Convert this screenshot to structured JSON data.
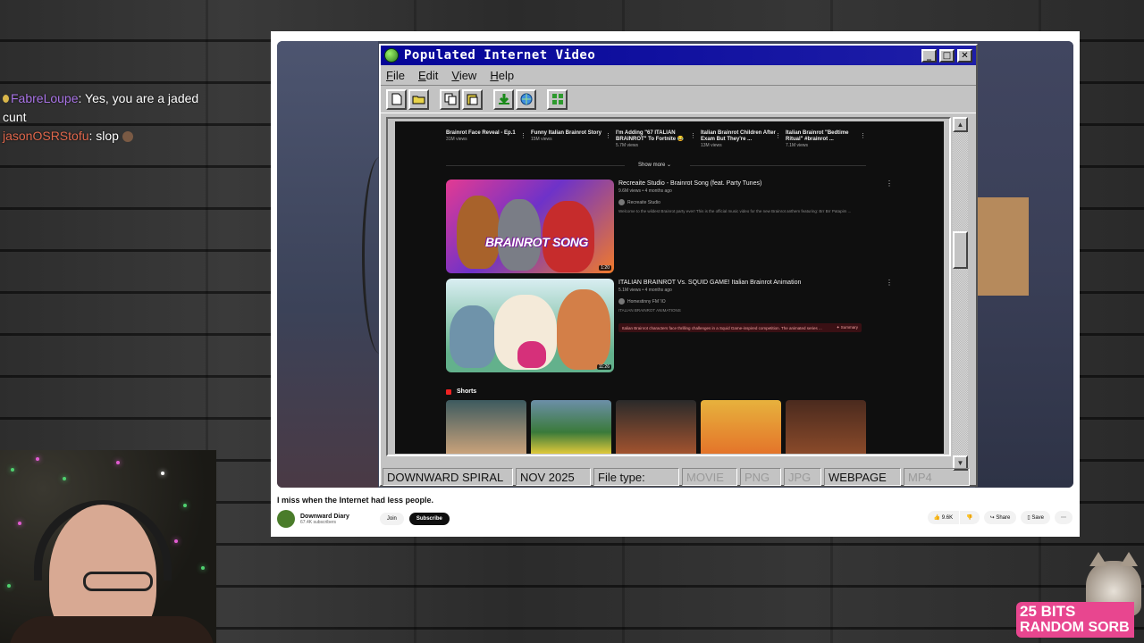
{
  "chat": {
    "messages": [
      {
        "user": "FabreLoupe",
        "text": ": Yes, you are a jaded cunt"
      },
      {
        "user": "jasonOSRStofu",
        "text": ": slop"
      }
    ]
  },
  "window": {
    "title": "Populated Internet Video",
    "menu": [
      "File",
      "Edit",
      "View",
      "Help"
    ],
    "minimize": "_",
    "maximize": "□",
    "close": "✕"
  },
  "status": {
    "channel": "DOWNWARD SPIRAL",
    "date": "NOV 2025",
    "file_type_label": "File type:",
    "types": [
      "MOVIE",
      "PNG",
      "JPG",
      "WEBPAGE",
      "MP4"
    ],
    "active_type": "WEBPAGE"
  },
  "inner_page": {
    "top_shorts": [
      {
        "title": "Brainrot Face Reveal - Ep.1",
        "views": "31M views"
      },
      {
        "title": "Funny Italian Brainrot Story",
        "views": "15M views"
      },
      {
        "title": "I'm Adding \"67 ITALIAN BRAINROT\" To Fortnite 😂",
        "views": "5.7M views"
      },
      {
        "title": "Italian Brainrot Children After Exam But They're ...",
        "views": "13M views"
      },
      {
        "title": "Italian Brainrot \"Bedtime Ritual\" #brainrot ...",
        "views": "7.1M views"
      }
    ],
    "show_more": "Show more ⌄",
    "videos": [
      {
        "title": "Recreaite Studio - Brainrot Song (feat. Party Tunes)",
        "meta": "9.6M views • 4 months ago",
        "channel": "Recreaite Studio",
        "description": "Welcome to the wildest Brainrot party ever! This is the official music video for the new Brainrot anthem featuring: Brr Brr Patapim ...",
        "thumb_caption": "BRAINROT SONG",
        "duration": "1:20"
      },
      {
        "title": "ITALIAN BRAINROT Vs. SQUID GAME! Italian Brainrot Animation",
        "meta": "5.1M views • 4 months ago",
        "channel": "Homestinny FM 'IO",
        "description": "ITALIAN BRAINROT ANIMATIONS",
        "summary": "Italian Brainrot characters face thrilling challenges in a Squid Game-inspired competition. The animated series ...",
        "summary_label": "✦ Summary",
        "duration": "11:26"
      }
    ],
    "shorts_label": "Shorts"
  },
  "youtube": {
    "video_title": "I miss when the Internet had less people.",
    "channel_name": "Downward Diary",
    "subscribers": "67.4K subscribers",
    "join": "Join",
    "subscribe": "Subscribe",
    "likes": "9.6K",
    "share": "Share",
    "save": "Save",
    "more": "⋯"
  },
  "bits": {
    "line1": "25 BITS",
    "line2": "RANDOM SORB"
  },
  "colors": {
    "titlebar": "#050598",
    "window_gray": "#c3c3c3",
    "bits_pink": "#e8468f",
    "chat_purple": "#a974e6",
    "chat_orange": "#e0674c"
  }
}
